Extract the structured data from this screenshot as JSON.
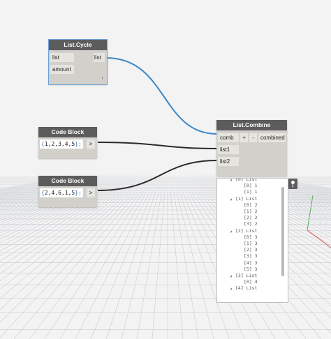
{
  "nodes": {
    "list_cycle": {
      "title": "List.Cycle",
      "inputs": [
        "list",
        "amount"
      ],
      "output": "list",
      "lacing": "l"
    },
    "code_block_1": {
      "title": "Code Block",
      "code_open": "{",
      "code_body": "1,2,3,4,5",
      "code_close": "};",
      "output": ">"
    },
    "code_block_2": {
      "title": "Code Block",
      "code_open": "{",
      "code_body": "2,4,6,1,5",
      "code_close": "};",
      "output": ">"
    },
    "list_combine": {
      "title": "List.Combine",
      "inputs": [
        "comb",
        "list1",
        "list2"
      ],
      "add_label": "+",
      "remove_label": "-",
      "output": "combined"
    }
  },
  "preview": {
    "rows": [
      {
        "indent": 3,
        "text": "[0] List",
        "tri": "◢"
      },
      {
        "indent": 4,
        "text": "[0] 1"
      },
      {
        "indent": 4,
        "text": "[1] 1"
      },
      {
        "indent": 3,
        "text": "[1] List",
        "tri": "◢"
      },
      {
        "indent": 4,
        "text": "[0] 2"
      },
      {
        "indent": 4,
        "text": "[1] 2"
      },
      {
        "indent": 4,
        "text": "[2] 2"
      },
      {
        "indent": 4,
        "text": "[3] 2"
      },
      {
        "indent": 3,
        "text": "[2] List",
        "tri": "◢"
      },
      {
        "indent": 4,
        "text": "[0] 3"
      },
      {
        "indent": 4,
        "text": "[1] 3"
      },
      {
        "indent": 4,
        "text": "[2] 3"
      },
      {
        "indent": 4,
        "text": "[3] 3"
      },
      {
        "indent": 4,
        "text": "[4] 3"
      },
      {
        "indent": 4,
        "text": "[5] 3"
      },
      {
        "indent": 3,
        "text": "[3] List",
        "tri": "◢"
      },
      {
        "indent": 4,
        "text": "[0] 4"
      },
      {
        "indent": 3,
        "text": "[4] List",
        "tri": "◢"
      }
    ]
  },
  "colors": {
    "wire_active": "#3a86c8",
    "wire_default": "#2b2b2b",
    "node_header": "#5c5c5c",
    "node_body": "#d2d0cb",
    "selection": "#6aa2d8"
  },
  "icons": {
    "pin": "pin-icon"
  }
}
